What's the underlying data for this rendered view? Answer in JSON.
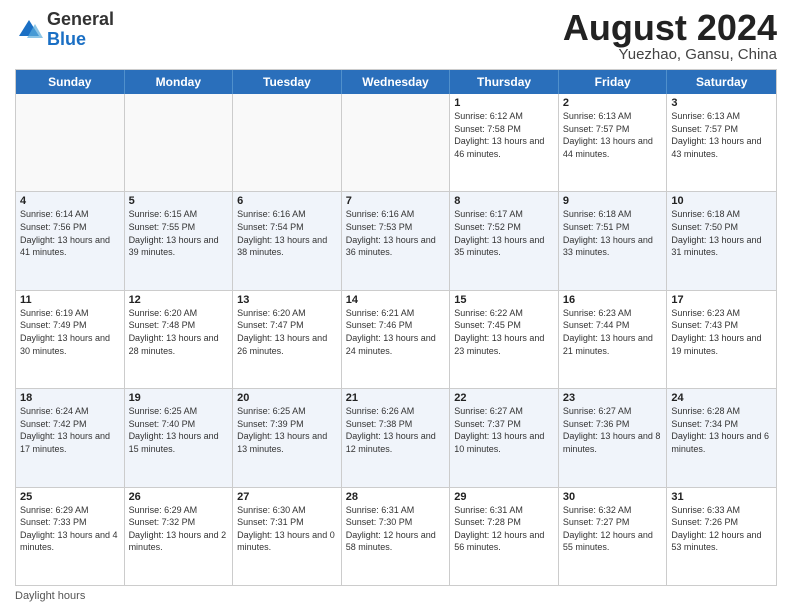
{
  "header": {
    "logo_line1": "General",
    "logo_line2": "Blue",
    "title": "August 2024",
    "location": "Yuezhao, Gansu, China"
  },
  "days_of_week": [
    "Sunday",
    "Monday",
    "Tuesday",
    "Wednesday",
    "Thursday",
    "Friday",
    "Saturday"
  ],
  "weeks": [
    [
      {
        "day": "",
        "info": ""
      },
      {
        "day": "",
        "info": ""
      },
      {
        "day": "",
        "info": ""
      },
      {
        "day": "",
        "info": ""
      },
      {
        "day": "1",
        "info": "Sunrise: 6:12 AM\nSunset: 7:58 PM\nDaylight: 13 hours and 46 minutes."
      },
      {
        "day": "2",
        "info": "Sunrise: 6:13 AM\nSunset: 7:57 PM\nDaylight: 13 hours and 44 minutes."
      },
      {
        "day": "3",
        "info": "Sunrise: 6:13 AM\nSunset: 7:57 PM\nDaylight: 13 hours and 43 minutes."
      }
    ],
    [
      {
        "day": "4",
        "info": "Sunrise: 6:14 AM\nSunset: 7:56 PM\nDaylight: 13 hours and 41 minutes."
      },
      {
        "day": "5",
        "info": "Sunrise: 6:15 AM\nSunset: 7:55 PM\nDaylight: 13 hours and 39 minutes."
      },
      {
        "day": "6",
        "info": "Sunrise: 6:16 AM\nSunset: 7:54 PM\nDaylight: 13 hours and 38 minutes."
      },
      {
        "day": "7",
        "info": "Sunrise: 6:16 AM\nSunset: 7:53 PM\nDaylight: 13 hours and 36 minutes."
      },
      {
        "day": "8",
        "info": "Sunrise: 6:17 AM\nSunset: 7:52 PM\nDaylight: 13 hours and 35 minutes."
      },
      {
        "day": "9",
        "info": "Sunrise: 6:18 AM\nSunset: 7:51 PM\nDaylight: 13 hours and 33 minutes."
      },
      {
        "day": "10",
        "info": "Sunrise: 6:18 AM\nSunset: 7:50 PM\nDaylight: 13 hours and 31 minutes."
      }
    ],
    [
      {
        "day": "11",
        "info": "Sunrise: 6:19 AM\nSunset: 7:49 PM\nDaylight: 13 hours and 30 minutes."
      },
      {
        "day": "12",
        "info": "Sunrise: 6:20 AM\nSunset: 7:48 PM\nDaylight: 13 hours and 28 minutes."
      },
      {
        "day": "13",
        "info": "Sunrise: 6:20 AM\nSunset: 7:47 PM\nDaylight: 13 hours and 26 minutes."
      },
      {
        "day": "14",
        "info": "Sunrise: 6:21 AM\nSunset: 7:46 PM\nDaylight: 13 hours and 24 minutes."
      },
      {
        "day": "15",
        "info": "Sunrise: 6:22 AM\nSunset: 7:45 PM\nDaylight: 13 hours and 23 minutes."
      },
      {
        "day": "16",
        "info": "Sunrise: 6:23 AM\nSunset: 7:44 PM\nDaylight: 13 hours and 21 minutes."
      },
      {
        "day": "17",
        "info": "Sunrise: 6:23 AM\nSunset: 7:43 PM\nDaylight: 13 hours and 19 minutes."
      }
    ],
    [
      {
        "day": "18",
        "info": "Sunrise: 6:24 AM\nSunset: 7:42 PM\nDaylight: 13 hours and 17 minutes."
      },
      {
        "day": "19",
        "info": "Sunrise: 6:25 AM\nSunset: 7:40 PM\nDaylight: 13 hours and 15 minutes."
      },
      {
        "day": "20",
        "info": "Sunrise: 6:25 AM\nSunset: 7:39 PM\nDaylight: 13 hours and 13 minutes."
      },
      {
        "day": "21",
        "info": "Sunrise: 6:26 AM\nSunset: 7:38 PM\nDaylight: 13 hours and 12 minutes."
      },
      {
        "day": "22",
        "info": "Sunrise: 6:27 AM\nSunset: 7:37 PM\nDaylight: 13 hours and 10 minutes."
      },
      {
        "day": "23",
        "info": "Sunrise: 6:27 AM\nSunset: 7:36 PM\nDaylight: 13 hours and 8 minutes."
      },
      {
        "day": "24",
        "info": "Sunrise: 6:28 AM\nSunset: 7:34 PM\nDaylight: 13 hours and 6 minutes."
      }
    ],
    [
      {
        "day": "25",
        "info": "Sunrise: 6:29 AM\nSunset: 7:33 PM\nDaylight: 13 hours and 4 minutes."
      },
      {
        "day": "26",
        "info": "Sunrise: 6:29 AM\nSunset: 7:32 PM\nDaylight: 13 hours and 2 minutes."
      },
      {
        "day": "27",
        "info": "Sunrise: 6:30 AM\nSunset: 7:31 PM\nDaylight: 13 hours and 0 minutes."
      },
      {
        "day": "28",
        "info": "Sunrise: 6:31 AM\nSunset: 7:30 PM\nDaylight: 12 hours and 58 minutes."
      },
      {
        "day": "29",
        "info": "Sunrise: 6:31 AM\nSunset: 7:28 PM\nDaylight: 12 hours and 56 minutes."
      },
      {
        "day": "30",
        "info": "Sunrise: 6:32 AM\nSunset: 7:27 PM\nDaylight: 12 hours and 55 minutes."
      },
      {
        "day": "31",
        "info": "Sunrise: 6:33 AM\nSunset: 7:26 PM\nDaylight: 12 hours and 53 minutes."
      }
    ]
  ],
  "footer": {
    "note": "Daylight hours"
  },
  "colors": {
    "header_bg": "#2a6fbb",
    "alt_bg": "#f0f4fa"
  }
}
